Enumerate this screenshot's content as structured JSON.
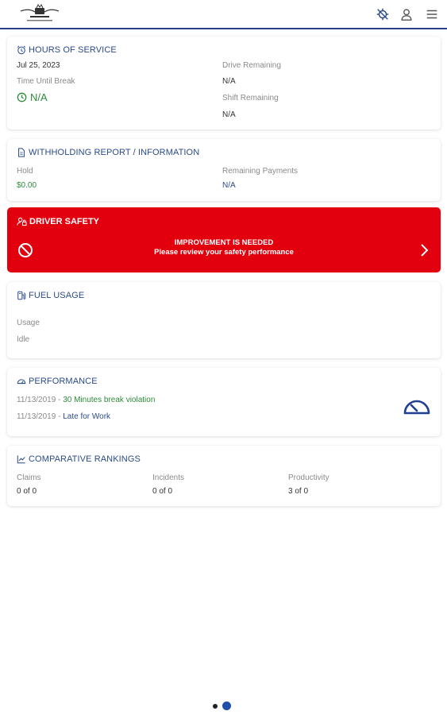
{
  "header": {
    "logo_icon": "company-crest-logo",
    "logo_text": "LOGO",
    "icons": [
      "location-off-icon",
      "user-icon",
      "menu-icon"
    ]
  },
  "hours_of_service": {
    "title": "HOURS OF SERVICE",
    "date": "Jul 25, 2023",
    "time_until_break_label": "Time Until Break",
    "time_until_break_value": "N/A",
    "drive_remaining_label": "Drive Remaining",
    "drive_remaining_value": "N/A",
    "shift_remaining_label": "Shift Remaining",
    "shift_remaining_value": "N/A"
  },
  "withholding": {
    "title": "WITHHOLDING REPORT / INFORMATION",
    "hold_label": "Hold",
    "hold_value": "$0.00",
    "remaining_payments_label": "Remaining Payments",
    "remaining_payments_value": "N/A"
  },
  "driver_safety": {
    "title": "DRIVER SAFETY",
    "message_line1": "IMPROVEMENT IS NEEDED",
    "message_line2": "Please review your safety performance",
    "color": "#e3000e"
  },
  "fuel_usage": {
    "title": "FUEL USAGE",
    "usage_label": "Usage",
    "idle_label": "Idle"
  },
  "performance": {
    "title": "PERFORMANCE",
    "items": [
      {
        "date": "11/13/2019",
        "sep": " - ",
        "text": "30 Minutes break violation"
      },
      {
        "date": "11/13/2019",
        "sep": " - ",
        "text": "Late for Work"
      }
    ]
  },
  "rankings": {
    "title": "COMPARATIVE RANKINGS",
    "columns": [
      {
        "label": "Claims",
        "value": "0 of 0"
      },
      {
        "label": "Incidents",
        "value": "0 of 0"
      },
      {
        "label": "Productivity",
        "value": "3 of 0"
      }
    ]
  },
  "pager": {
    "pages": 2,
    "current": 2
  },
  "colors": {
    "brand_blue": "#2b4a8a",
    "alert_red": "#e3000e",
    "good_green": "#2e8b3b"
  }
}
